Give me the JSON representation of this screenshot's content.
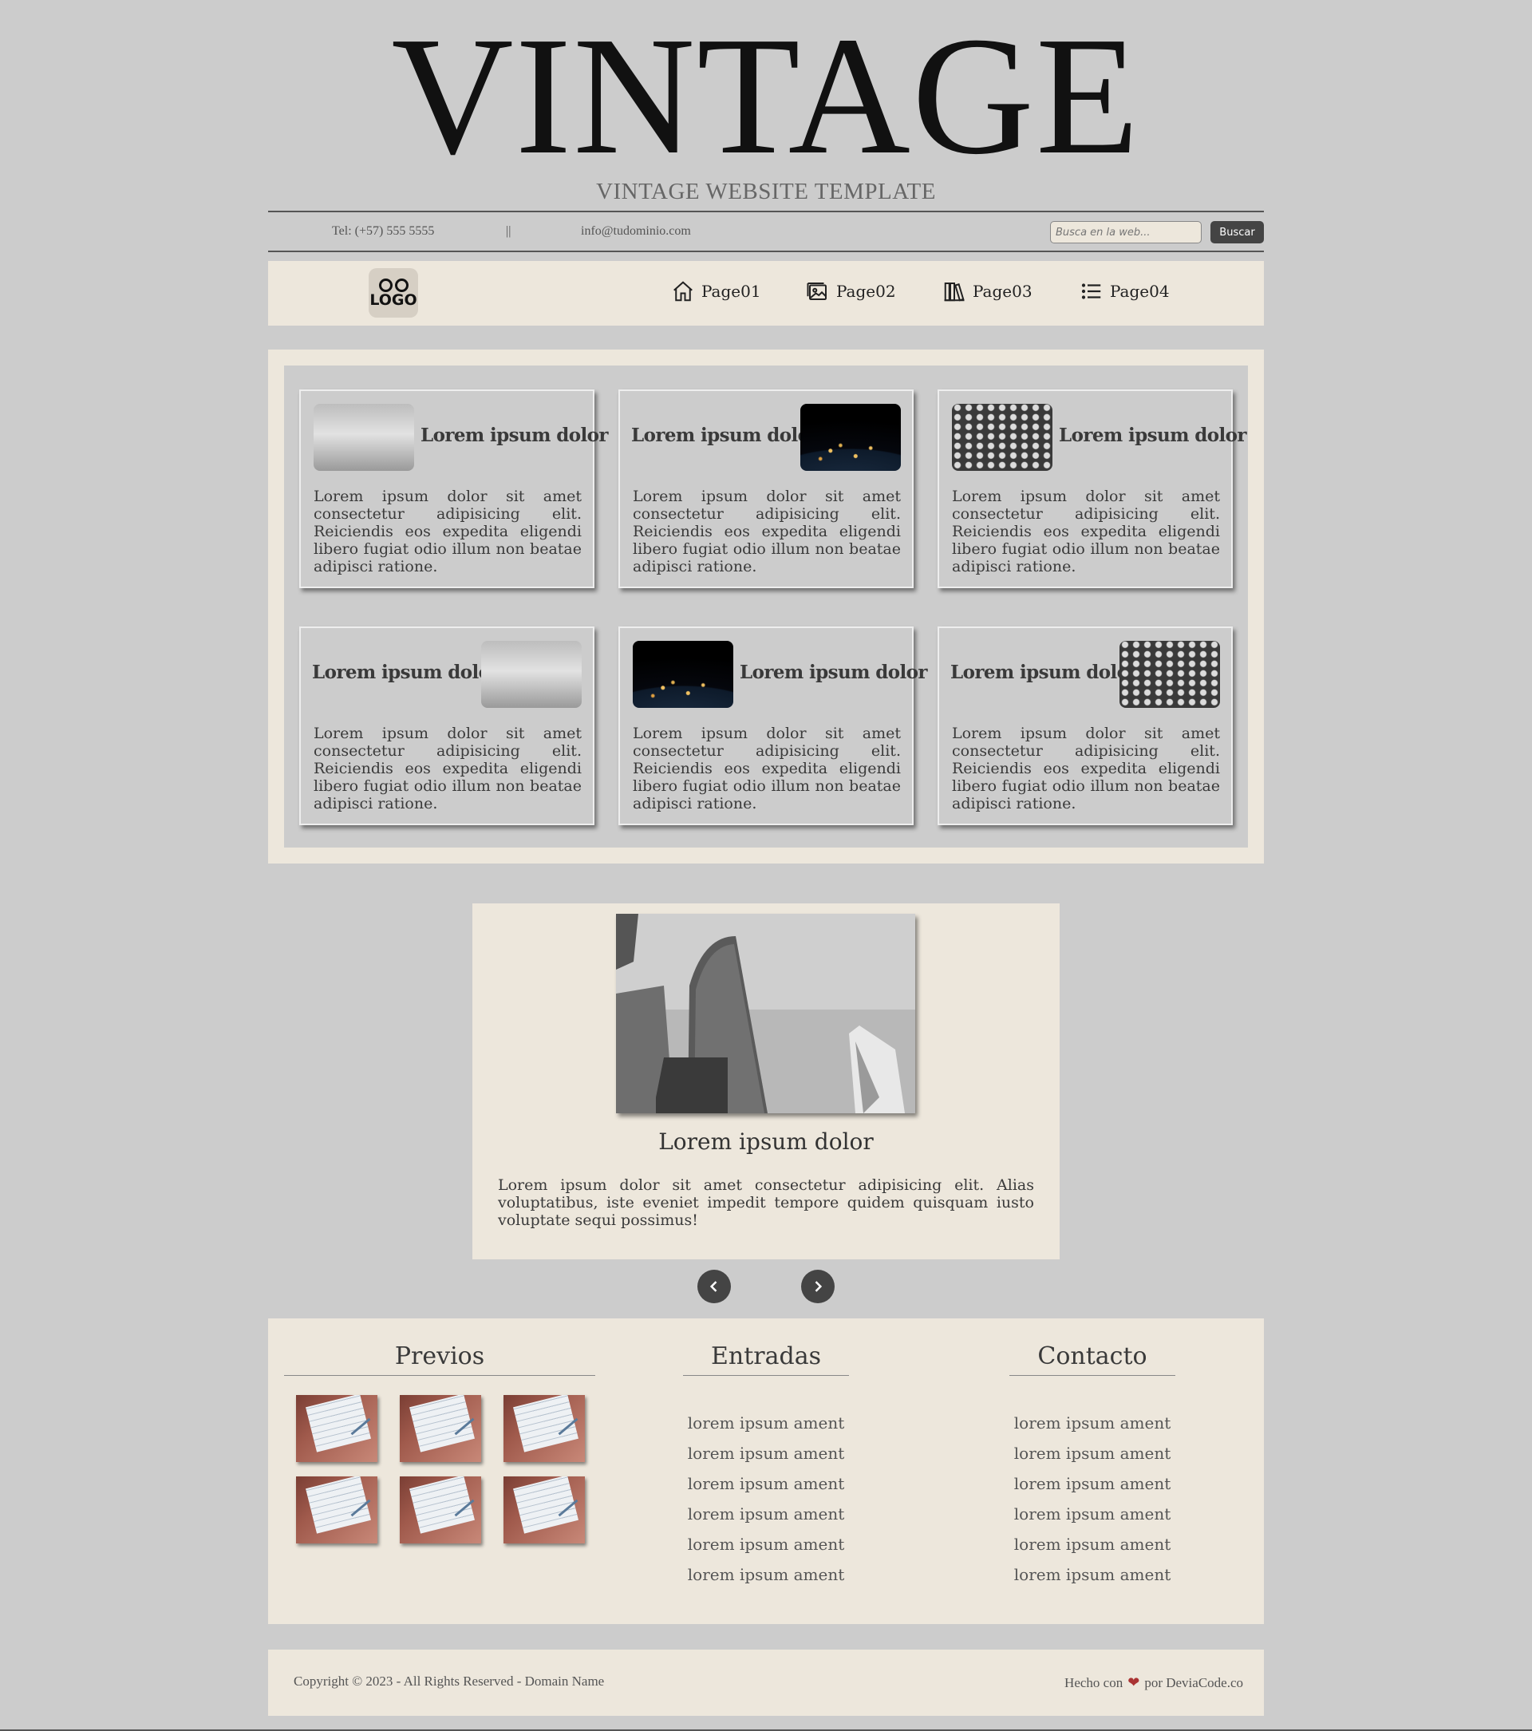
{
  "header": {
    "title": "VINTAGE",
    "subtitle": "VINTAGE WEBSITE TEMPLATE"
  },
  "infobar": {
    "tel": "Tel: (+57) 555 5555",
    "separator": "||",
    "email": "info@tudominio.com",
    "search_placeholder": "Busca en la web...",
    "search_button": "Buscar"
  },
  "nav": {
    "logo_text": "LOGO",
    "items": [
      {
        "label": "Page01",
        "icon": "home-icon"
      },
      {
        "label": "Page02",
        "icon": "image-icon"
      },
      {
        "label": "Page03",
        "icon": "books-icon"
      },
      {
        "label": "Page04",
        "icon": "list-icon"
      }
    ]
  },
  "cards": [
    {
      "title": "Lorem ipsum dolor",
      "text": "Lorem ipsum dolor sit amet consectetur adipisicing elit. Reiciendis eos expedita eligendi libero fugiat odio illum non beatae adipisci ratione.",
      "image": "building"
    },
    {
      "title": "Lorem ipsum dolor",
      "text": "Lorem ipsum dolor sit amet consectetur adipisicing elit. Reiciendis eos expedita eligendi libero fugiat odio illum non beatae adipisci ratione.",
      "image": "earth"
    },
    {
      "title": "Lorem ipsum dolor",
      "text": "Lorem ipsum dolor sit amet consectetur adipisicing elit. Reiciendis eos expedita eligendi libero fugiat odio illum non beatae adipisci ratione.",
      "image": "keys"
    },
    {
      "title": "Lorem ipsum dolor",
      "text": "Lorem ipsum dolor sit amet consectetur adipisicing elit. Reiciendis eos expedita eligendi libero fugiat odio illum non beatae adipisci ratione.",
      "image": "building"
    },
    {
      "title": "Lorem ipsum dolor",
      "text": "Lorem ipsum dolor sit amet consectetur adipisicing elit. Reiciendis eos expedita eligendi libero fugiat odio illum non beatae adipisci ratione.",
      "image": "earth"
    },
    {
      "title": "Lorem ipsum dolor",
      "text": "Lorem ipsum dolor sit amet consectetur adipisicing elit. Reiciendis eos expedita eligendi libero fugiat odio illum non beatae adipisci ratione.",
      "image": "keys"
    }
  ],
  "featured": {
    "title": "Lorem ipsum dolor",
    "text": "Lorem ipsum dolor sit amet consectetur adipisicing elit. Alias voluptatibus, iste eveniet impedit tempore quidem quisquam iusto voluptate sequi possimus!"
  },
  "footer_columns": {
    "previos": {
      "heading": "Previos"
    },
    "entradas": {
      "heading": "Entradas",
      "links": [
        "lorem ipsum ament",
        "lorem ipsum ament",
        "lorem ipsum ament",
        "lorem ipsum ament",
        "lorem ipsum ament",
        "lorem ipsum ament"
      ]
    },
    "contacto": {
      "heading": "Contacto",
      "links": [
        "lorem ipsum ament",
        "lorem ipsum ament",
        "lorem ipsum ament",
        "lorem ipsum ament",
        "lorem ipsum ament",
        "lorem ipsum ament"
      ]
    }
  },
  "footer": {
    "copyright": "Copyright © 2023 - All Rights Reserved - Domain Name",
    "made_prefix": "Hecho con",
    "made_suffix": "por DeviaCode.co"
  },
  "colors": {
    "page_bg": "#cccccc",
    "panel_bg": "#ede7dc",
    "button_dark": "#444444",
    "heart": "#aa3333"
  }
}
